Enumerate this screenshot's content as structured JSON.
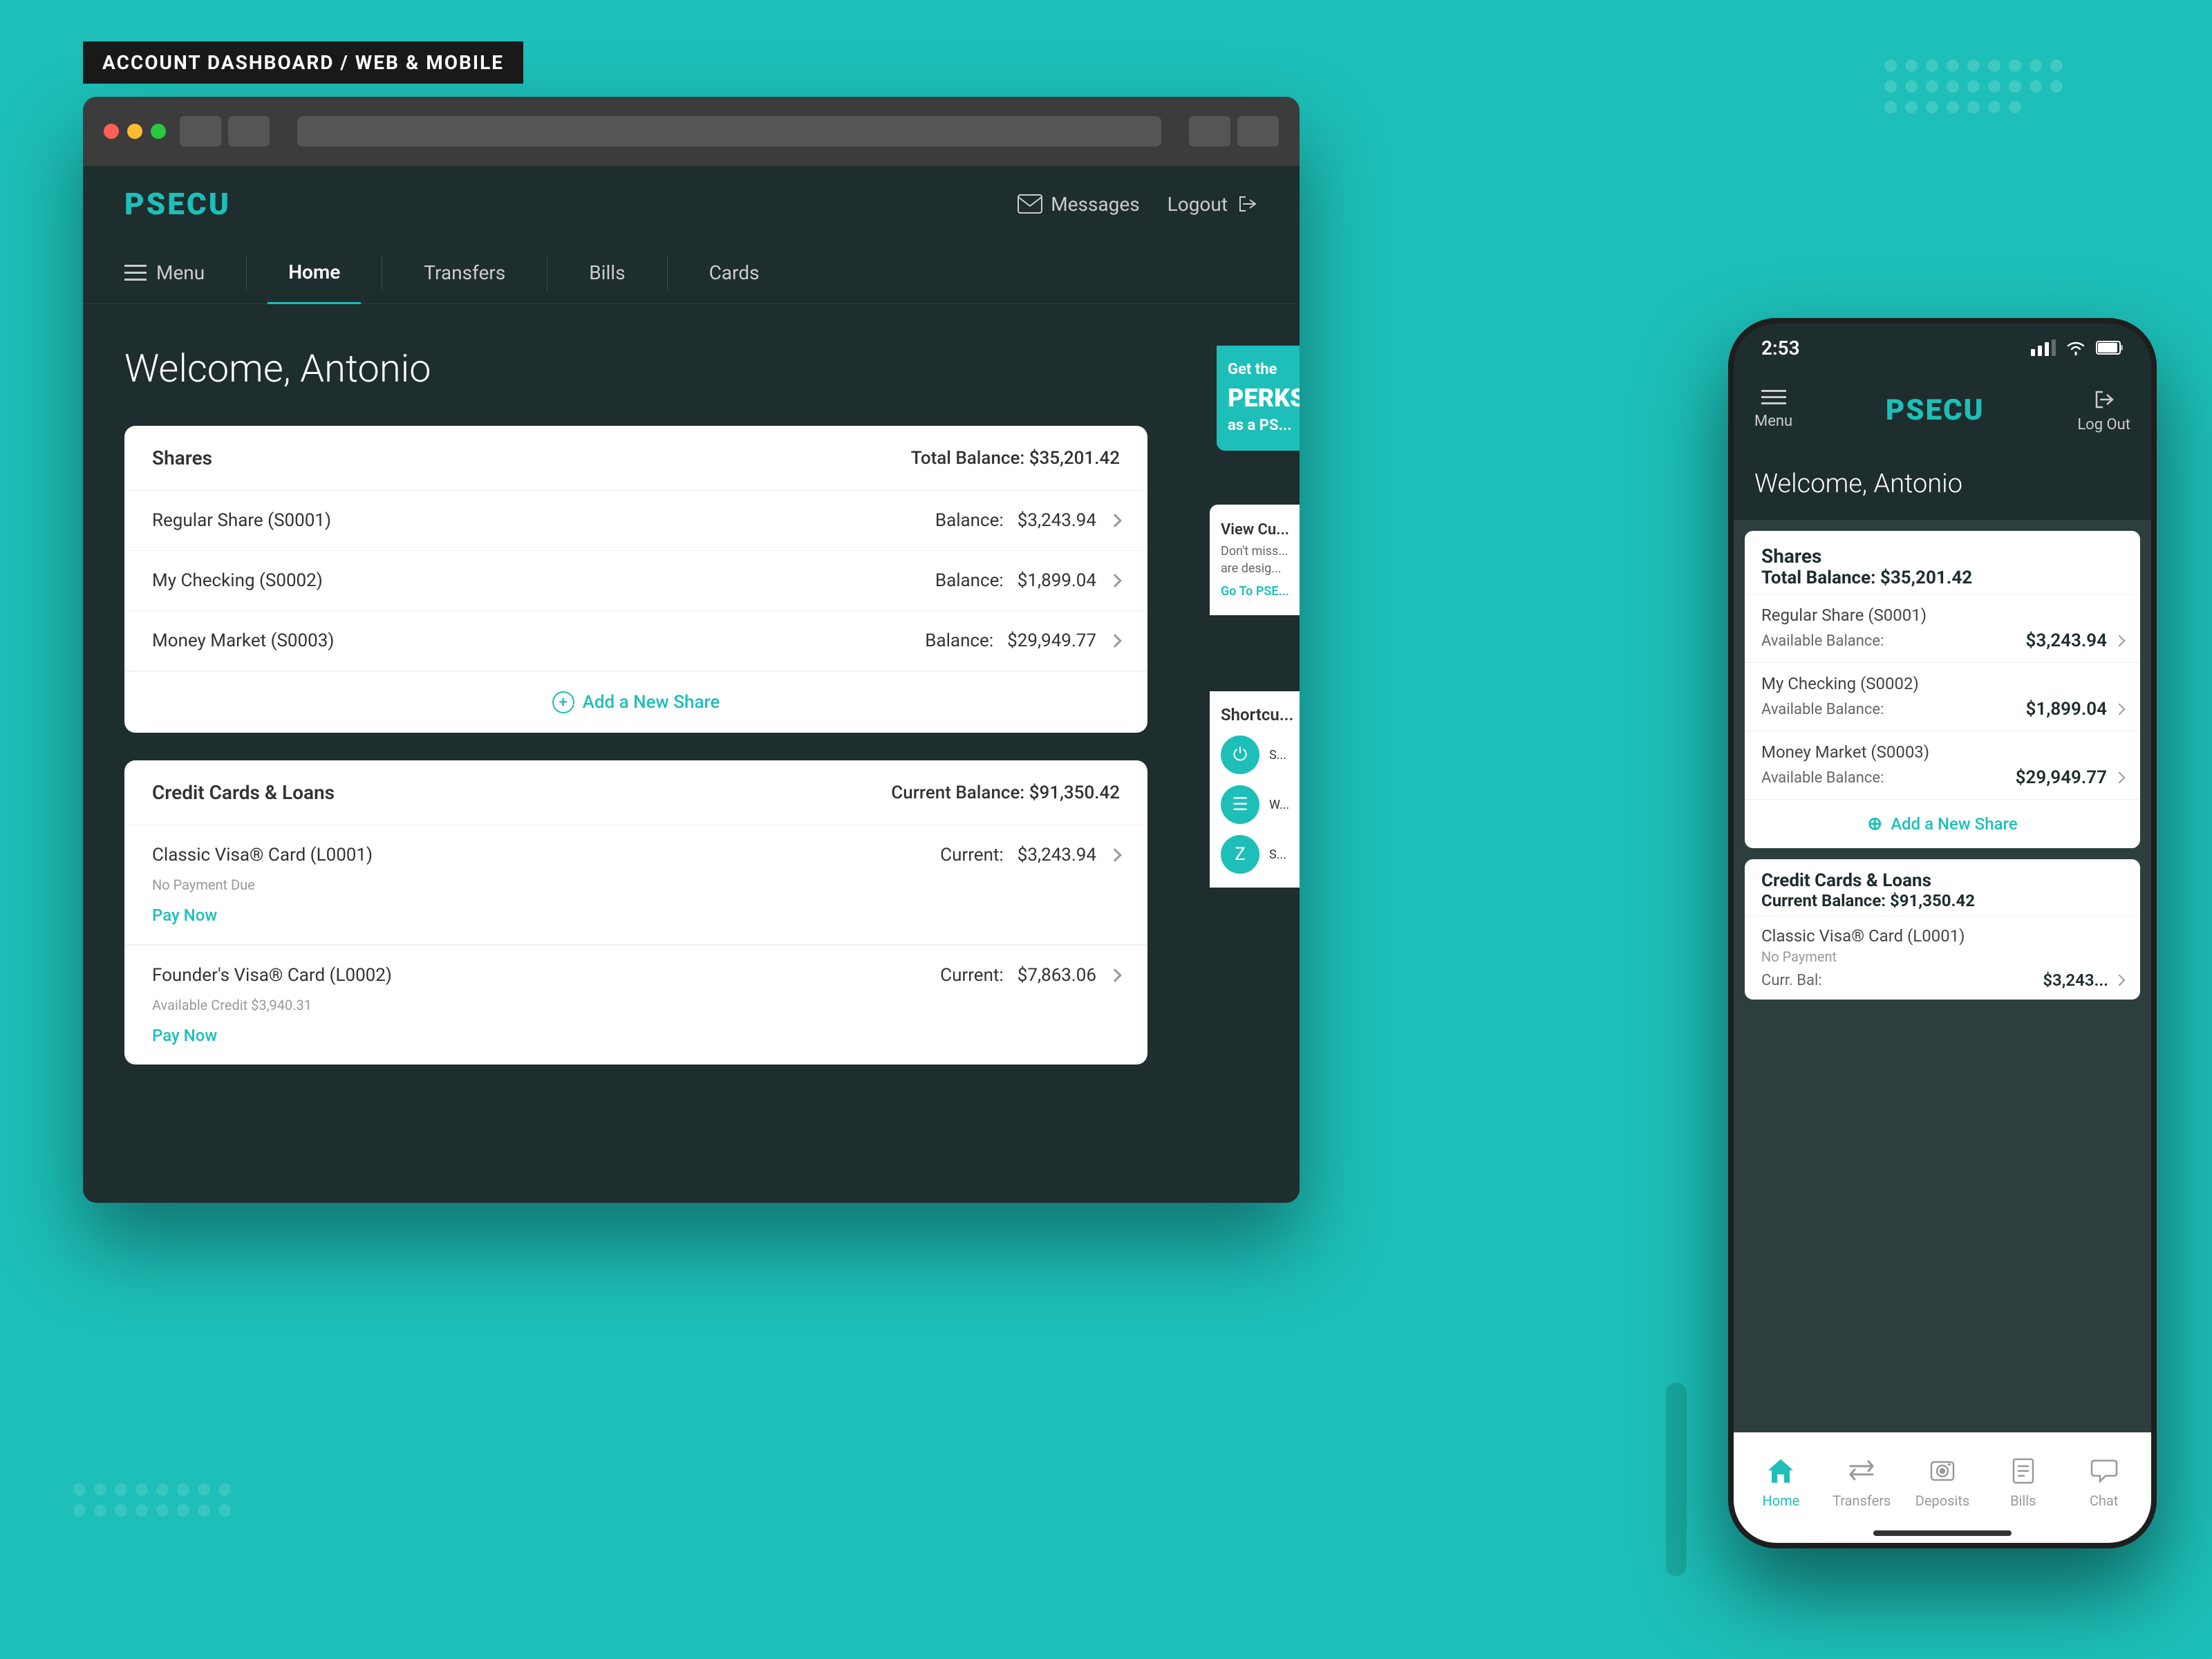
{
  "label": {
    "text": "ACCOUNT DASHBOARD / WEB & MOBILE"
  },
  "browser": {
    "dots": [
      "red",
      "yellow",
      "green"
    ]
  },
  "web": {
    "logo": "PSECU",
    "header": {
      "messages_label": "Messages",
      "logout_label": "Logout"
    },
    "nav": {
      "menu_label": "Menu",
      "items": [
        {
          "label": "Home",
          "active": true
        },
        {
          "label": "Transfers",
          "active": false
        },
        {
          "label": "Bills",
          "active": false
        },
        {
          "label": "Cards",
          "active": false
        }
      ]
    },
    "welcome": "Welcome, Antonio",
    "shares": {
      "title": "Shares",
      "total_balance": "Total Balance: $35,201.42",
      "accounts": [
        {
          "name": "Regular Share (S0001)",
          "balance_label": "Balance:",
          "balance": "$3,243.94"
        },
        {
          "name": "My Checking (S0002)",
          "balance_label": "Balance:",
          "balance": "$1,899.04"
        },
        {
          "name": "Money Market (S0003)",
          "balance_label": "Balance:",
          "balance": "$29,949.77"
        }
      ],
      "add_label": "Add a New Share"
    },
    "credit": {
      "title": "Credit Cards & Loans",
      "current_balance": "Current Balance: $91,350.42",
      "cards": [
        {
          "name": "Classic Visa® Card (L0001)",
          "sub": "No Payment Due",
          "balance_label": "Current:",
          "balance": "$3,243.94",
          "pay_label": "Pay Now"
        },
        {
          "name": "Founder's Visa® Card (L0002)",
          "sub": "Available Credit $3,940.31",
          "balance_label": "Current:",
          "balance": "$7,863.06",
          "pay_label": "Pay Now"
        }
      ]
    },
    "promo": {
      "line1": "Get the",
      "line2": "PERKS",
      "line3": "as a PS..."
    },
    "view_cu_label": "View Cu...",
    "shortcuts_label": "Shortcu..."
  },
  "mobile": {
    "status_bar": {
      "time": "2:53",
      "signal": "▐▌▌",
      "wifi": "WiFi",
      "battery": "Battery"
    },
    "logo": "PSECU",
    "menu_label": "Menu",
    "logout_label": "Log Out",
    "welcome": "Welcome, Antonio",
    "shares": {
      "title": "Shares",
      "total_balance": "Total Balance: $35,201.42",
      "accounts": [
        {
          "name": "Regular Share (S0001)",
          "balance_label": "Available Balance:",
          "balance": "$3,243.94"
        },
        {
          "name": "My Checking (S0002)",
          "balance_label": "Available Balance:",
          "balance": "$1,899.04"
        },
        {
          "name": "Money Market (S0003)",
          "balance_label": "Available Balance:",
          "balance": "$29,949.77"
        }
      ],
      "add_label": "Add a New Share"
    },
    "credit": {
      "title": "Credit Cards & Loans",
      "current_balance": "Current Balance: $91,350.42",
      "cards": [
        {
          "name": "Classic Visa® Card (L0001)",
          "sub": "No Payment",
          "balance_label": "Curr. Bal:",
          "balance": "$3,243..."
        }
      ]
    },
    "bottom_nav": [
      {
        "label": "Home",
        "active": true,
        "icon": "⌂"
      },
      {
        "label": "Transfers",
        "active": false,
        "icon": "⇄"
      },
      {
        "label": "Deposits",
        "active": false,
        "icon": "📷"
      },
      {
        "label": "Bills",
        "active": false,
        "icon": "☰"
      },
      {
        "label": "Chat",
        "active": false,
        "icon": "💬"
      }
    ]
  }
}
